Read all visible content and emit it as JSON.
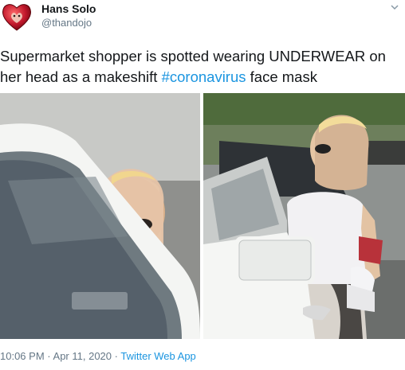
{
  "tweet": {
    "author_name": "Hans Solo",
    "author_handle": "@thandojo",
    "text_before": "Supermarket shopper is spotted wearing UNDERWEAR on her head as a makeshift ",
    "hashtag": "#coronavirus",
    "text_after": " face mask",
    "time": "10:06 PM",
    "separator": "·",
    "date": "Apr 11, 2020",
    "source": "Twitter Web App"
  },
  "icons": {
    "avatar": "heart-avatar",
    "menu": "chevron-down-icon"
  },
  "colors": {
    "link": "#1b95e0",
    "text": "#14171a",
    "muted": "#657786",
    "avatar_heart": "#c0172b"
  }
}
